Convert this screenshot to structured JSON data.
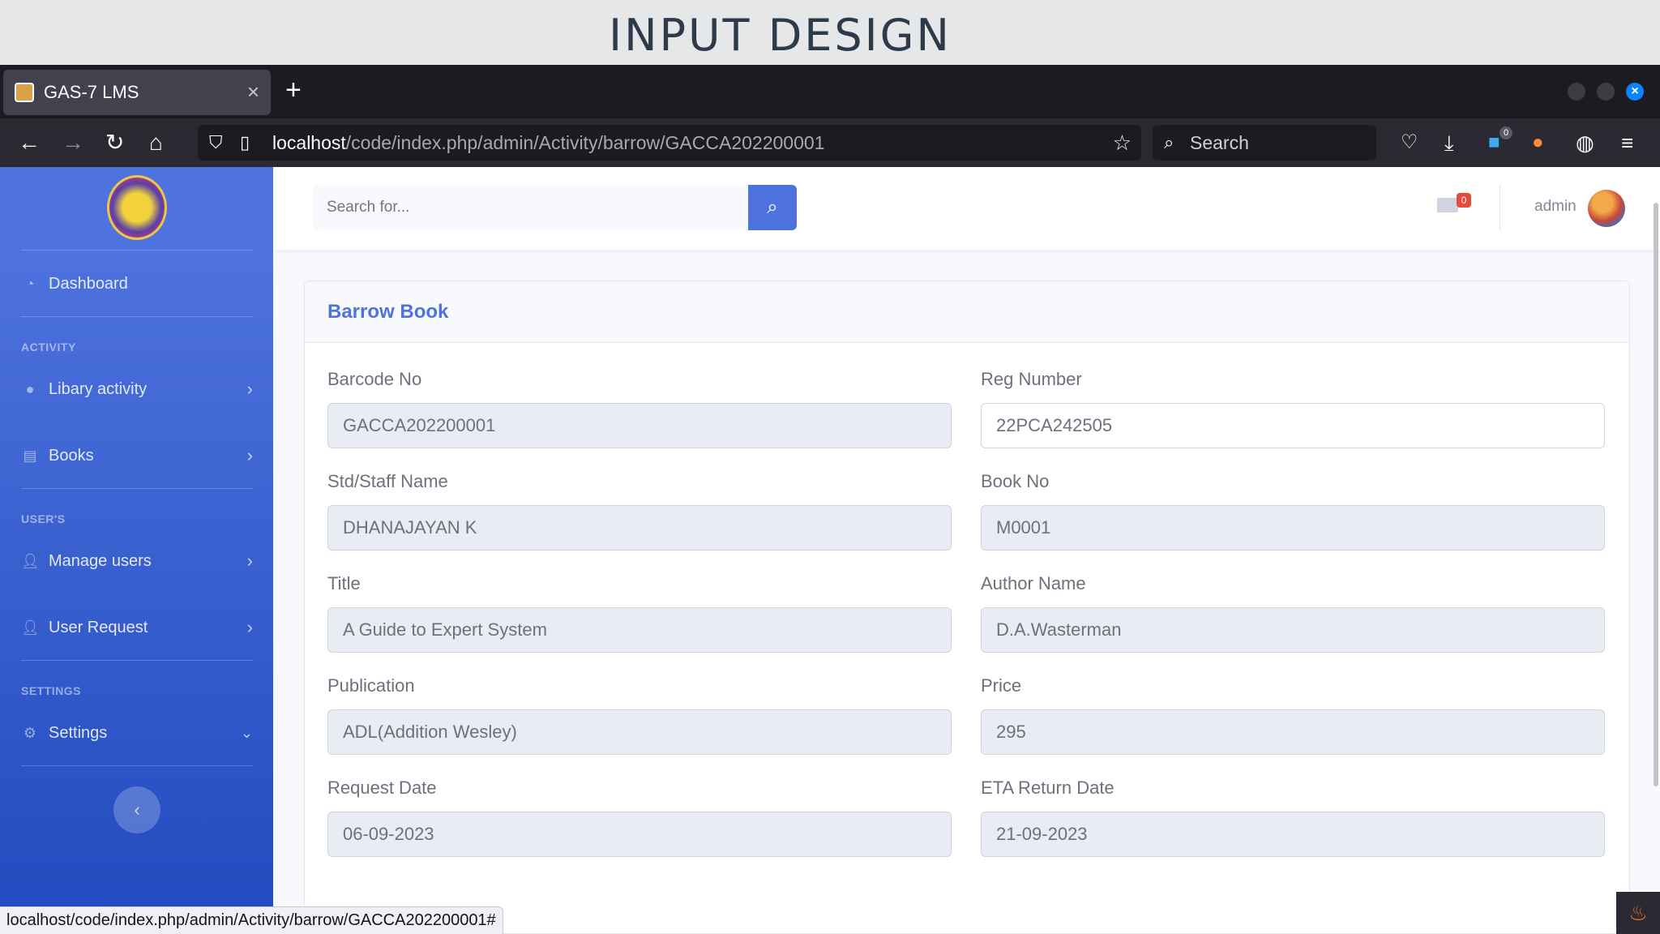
{
  "slide_title": "INPUT DESIGN",
  "browser": {
    "tab_title": "GAS-7 LMS",
    "tab_close": "×",
    "new_tab": "+",
    "url_host": "localhost",
    "url_path": "/code/index.php/admin/Activity/barrow/GACCA202200001",
    "search_placeholder": "Search",
    "extension_badge": "0",
    "status_url": "localhost/code/index.php/admin/Activity/barrow/GACCA202200001#"
  },
  "sidebar": {
    "dashboard": "Dashboard",
    "heading_activity": "ACTIVITY",
    "library_activity": "Libary activity",
    "books": "Books",
    "heading_users": "USER'S",
    "manage_users": "Manage users",
    "user_request": "User Request",
    "heading_settings": "SETTINGS",
    "settings": "Settings"
  },
  "topbar": {
    "search_placeholder": "Search for...",
    "mail_count": "0",
    "username": "admin"
  },
  "card": {
    "title": "Barrow Book"
  },
  "form": {
    "barcode_label": "Barcode No",
    "barcode_value": "GACCA202200001",
    "reg_label": "Reg Number",
    "reg_value": "22PCA242505",
    "name_label": "Std/Staff Name",
    "name_value": "DHANAJAYAN  K",
    "bookno_label": "Book No",
    "bookno_value": "M0001",
    "title_label": "Title",
    "title_value": "A Guide to Expert System",
    "author_label": "Author Name",
    "author_value": "D.A.Wasterman",
    "publication_label": "Publication",
    "publication_value": "ADL(Addition Wesley)",
    "price_label": "Price",
    "price_value": "295",
    "request_label": "Request Date",
    "request_value": "06-09-2023",
    "eta_label": "ETA Return Date",
    "eta_value": "21-09-2023"
  },
  "colors": {
    "sidebar_top": "#4e73df",
    "sidebar_bottom": "#224abe",
    "accent": "#4e73df",
    "badge": "#e74a3b"
  }
}
